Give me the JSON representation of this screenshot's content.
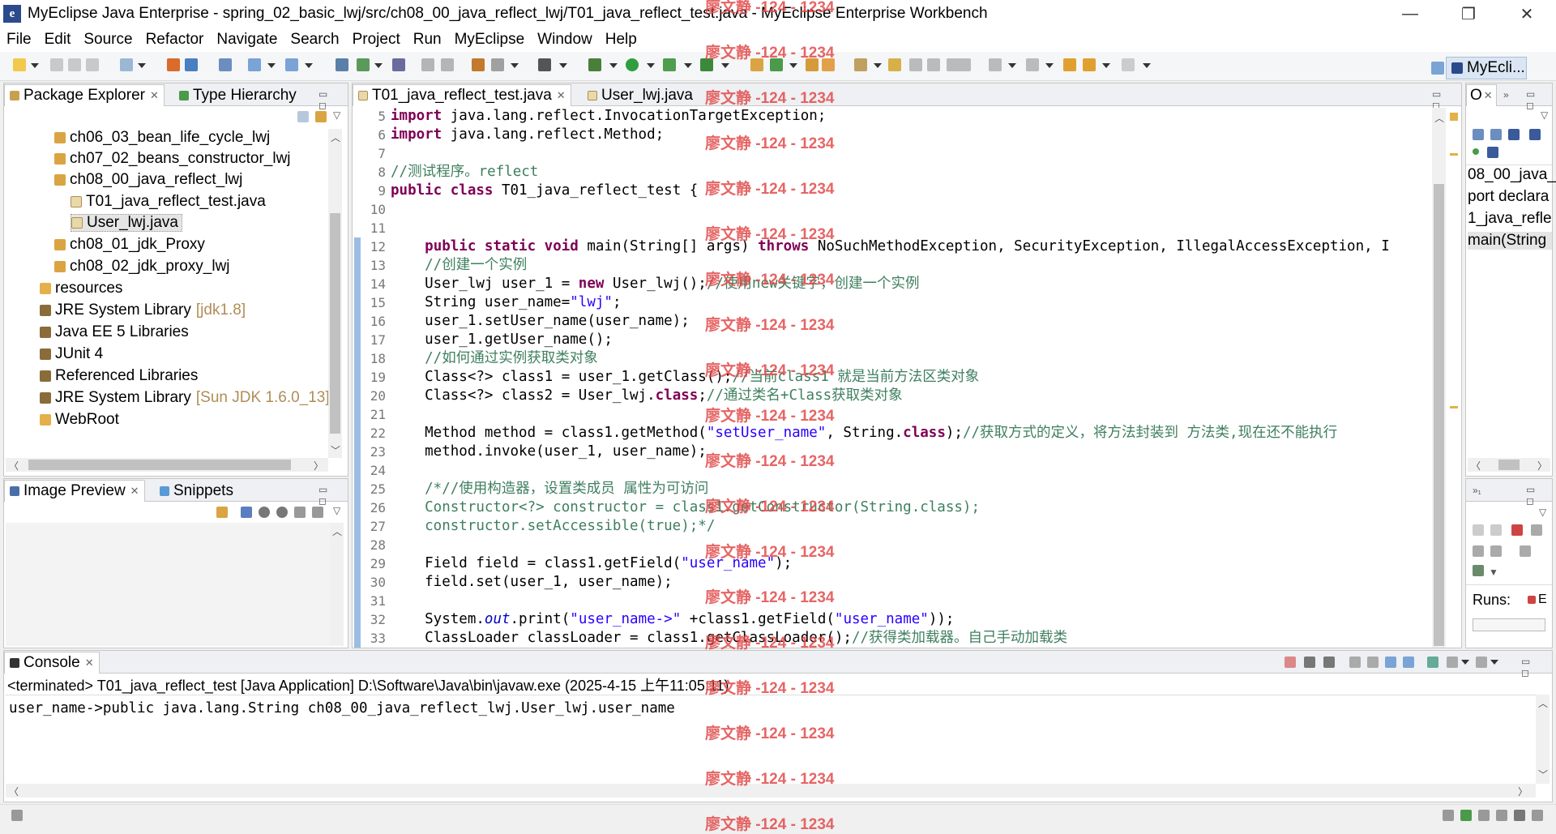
{
  "window": {
    "title": "MyEclipse Java Enterprise - spring_02_basic_lwj/src/ch08_00_java_reflect_lwj/T01_java_reflect_test.java - MyEclipse Enterprise Workbench",
    "minimize": "—",
    "restore": "❐",
    "close": "✕"
  },
  "menu": [
    "File",
    "Edit",
    "Source",
    "Refactor",
    "Navigate",
    "Search",
    "Project",
    "Run",
    "MyEclipse",
    "Window",
    "Help"
  ],
  "perspective": "MyEcli...",
  "package_explorer": {
    "tabs": [
      "Package Explorer",
      "Type Hierarchy"
    ],
    "items": [
      {
        "label": "ch06_03_bean_life_cycle_lwj",
        "suffix": "",
        "icon": "package-icon"
      },
      {
        "label": "ch07_02_beans_constructor_lwj",
        "suffix": "",
        "icon": "package-icon"
      },
      {
        "label": "ch08_00_java_reflect_lwj",
        "suffix": "",
        "icon": "package-icon"
      },
      {
        "label": "T01_java_reflect_test.java",
        "suffix": "",
        "icon": "java-file-icon"
      },
      {
        "label": "User_lwj.java",
        "suffix": "",
        "icon": "java-file-icon"
      },
      {
        "label": "ch08_01_jdk_Proxy",
        "suffix": "",
        "icon": "package-icon"
      },
      {
        "label": "ch08_02_jdk_proxy_lwj",
        "suffix": "",
        "icon": "package-icon"
      },
      {
        "label": "resources",
        "suffix": "",
        "icon": "folder-icon"
      },
      {
        "label": "JRE System Library",
        "suffix": "[jdk1.8]",
        "icon": "library-icon"
      },
      {
        "label": "Java EE 5 Libraries",
        "suffix": "",
        "icon": "library-icon"
      },
      {
        "label": "JUnit 4",
        "suffix": "",
        "icon": "library-icon"
      },
      {
        "label": "Referenced Libraries",
        "suffix": "",
        "icon": "library-icon"
      },
      {
        "label": "JRE System Library",
        "suffix": "[Sun JDK 1.6.0_13]",
        "icon": "library-icon"
      },
      {
        "label": "WebRoot",
        "suffix": "",
        "icon": "folder-icon"
      }
    ]
  },
  "image_preview": {
    "tabs": [
      "Image Preview",
      "Snippets"
    ]
  },
  "editor": {
    "tabs": [
      "T01_java_reflect_test.java",
      "User_lwj.java"
    ],
    "lines": [
      {
        "n": "5",
        "segs": [
          [
            "kw",
            "import"
          ],
          [
            "",
            "java.lang.reflect.InvocationTargetException;"
          ]
        ]
      },
      {
        "n": "6",
        "segs": [
          [
            "kw",
            "import"
          ],
          [
            "",
            "java.lang.reflect.Method;"
          ]
        ]
      },
      {
        "n": "7",
        "segs": []
      },
      {
        "n": "8",
        "segs": [
          [
            "cm",
            "//测试程序。reflect"
          ]
        ]
      },
      {
        "n": "9",
        "segs": [
          [
            "kw",
            "public class"
          ],
          [
            "",
            "T01_java_reflect_test {"
          ]
        ]
      },
      {
        "n": "10",
        "segs": []
      },
      {
        "n": "11",
        "segs": []
      },
      {
        "n": "12",
        "segs": [
          [
            "",
            "    "
          ],
          [
            "kw",
            "public static void"
          ],
          [
            "",
            "main(String[] args) "
          ],
          [
            "kw",
            "throws"
          ],
          [
            "",
            "NoSuchMethodException, SecurityException, IllegalAccessException, I"
          ]
        ]
      },
      {
        "n": "13",
        "segs": [
          [
            "cm",
            "    //创建一个实例"
          ]
        ]
      },
      {
        "n": "14",
        "segs": [
          [
            "",
            "    User_lwj user_1 = "
          ],
          [
            "kw",
            "new"
          ],
          [
            "",
            "User_lwj();"
          ],
          [
            "cm",
            "//使用new关键字，创建一个实例"
          ]
        ]
      },
      {
        "n": "15",
        "segs": [
          [
            "",
            "    String user_name="
          ],
          [
            "st",
            "\"lwj\""
          ],
          [
            "",
            ";"
          ]
        ]
      },
      {
        "n": "16",
        "segs": [
          [
            "",
            "    user_1.setUser_name(user_name);"
          ]
        ]
      },
      {
        "n": "17",
        "segs": [
          [
            "",
            "    user_1.getUser_name();"
          ]
        ]
      },
      {
        "n": "18",
        "segs": [
          [
            "cm",
            "    //如何通过实例获取类对象"
          ]
        ]
      },
      {
        "n": "19",
        "segs": [
          [
            "",
            "    Class<?> class1 = user_1.getClass();"
          ],
          [
            "cm",
            "//当前class1 就是当前方法区类对象"
          ]
        ]
      },
      {
        "n": "20",
        "segs": [
          [
            "",
            "    Class<?> class2 = User_lwj."
          ],
          [
            "kw",
            "class"
          ],
          [
            "",
            ";"
          ],
          [
            "cm",
            "//通过类名+Class获取类对象"
          ]
        ]
      },
      {
        "n": "21",
        "segs": []
      },
      {
        "n": "22",
        "segs": [
          [
            "",
            "    Method method = class1.getMethod("
          ],
          [
            "st",
            "\"setUser_name\""
          ],
          [
            "",
            ", String."
          ],
          [
            "kw",
            "class"
          ],
          [
            "",
            ");"
          ],
          [
            "cm",
            "//获取方式的定义，将方法封装到 方法类,现在还不能执行"
          ]
        ]
      },
      {
        "n": "23",
        "segs": [
          [
            "",
            "    method.invoke(user_1, user_name);"
          ]
        ]
      },
      {
        "n": "24",
        "segs": []
      },
      {
        "n": "25",
        "segs": [
          [
            "cm",
            "    /*//使用构造器，设置类成员 属性为可访问"
          ]
        ]
      },
      {
        "n": "26",
        "segs": [
          [
            "cm",
            "    Constructor<?> constructor = class1.getConstructor(String.class);"
          ]
        ]
      },
      {
        "n": "27",
        "segs": [
          [
            "cm",
            "    constructor.setAccessible(true);*/"
          ]
        ]
      },
      {
        "n": "28",
        "segs": []
      },
      {
        "n": "29",
        "segs": [
          [
            "",
            "    Field field = class1.getField("
          ],
          [
            "st",
            "\"user_name\""
          ],
          [
            "",
            ");"
          ]
        ]
      },
      {
        "n": "30",
        "segs": [
          [
            "",
            "    field.set(user_1, user_name);"
          ]
        ]
      },
      {
        "n": "31",
        "segs": []
      },
      {
        "n": "32",
        "segs": [
          [
            "",
            "    System."
          ],
          [
            "it",
            "out"
          ],
          [
            "",
            ".print("
          ],
          [
            "st",
            "\"user_name->\""
          ],
          [
            "",
            "+class1.getField("
          ],
          [
            "st",
            "\"user_name\""
          ],
          [
            "",
            "));"
          ]
        ]
      },
      {
        "n": "33",
        "segs": [
          [
            "",
            "    ClassLoader classLoader = class1.getClassLoader();"
          ],
          [
            "cm",
            "//获得类加载器。自己手动加载类"
          ]
        ]
      }
    ]
  },
  "outline": {
    "tab": "O",
    "items": [
      "08_00_java_",
      "port declara",
      "1_java_refle",
      "main(String"
    ]
  },
  "runs_panel": {
    "label": "Runs:",
    "value": "E"
  },
  "console": {
    "tab": "Console",
    "header": "<terminated> T01_java_reflect_test [Java Application] D:\\Software\\Java\\bin\\javaw.exe (2025-4-15 上午11:05:11)",
    "output": "user_name->public java.lang.String ch08_00_java_reflect_lwj.User_lwj.user_name"
  },
  "watermark": "廖文静 -124 - 1234",
  "colors": {
    "keyword": "#7f0055",
    "comment": "#3f7f5f",
    "string": "#2a00ff",
    "field": "#0000c0",
    "watermark": "#e24b4b",
    "decoration": "#b08d57"
  }
}
